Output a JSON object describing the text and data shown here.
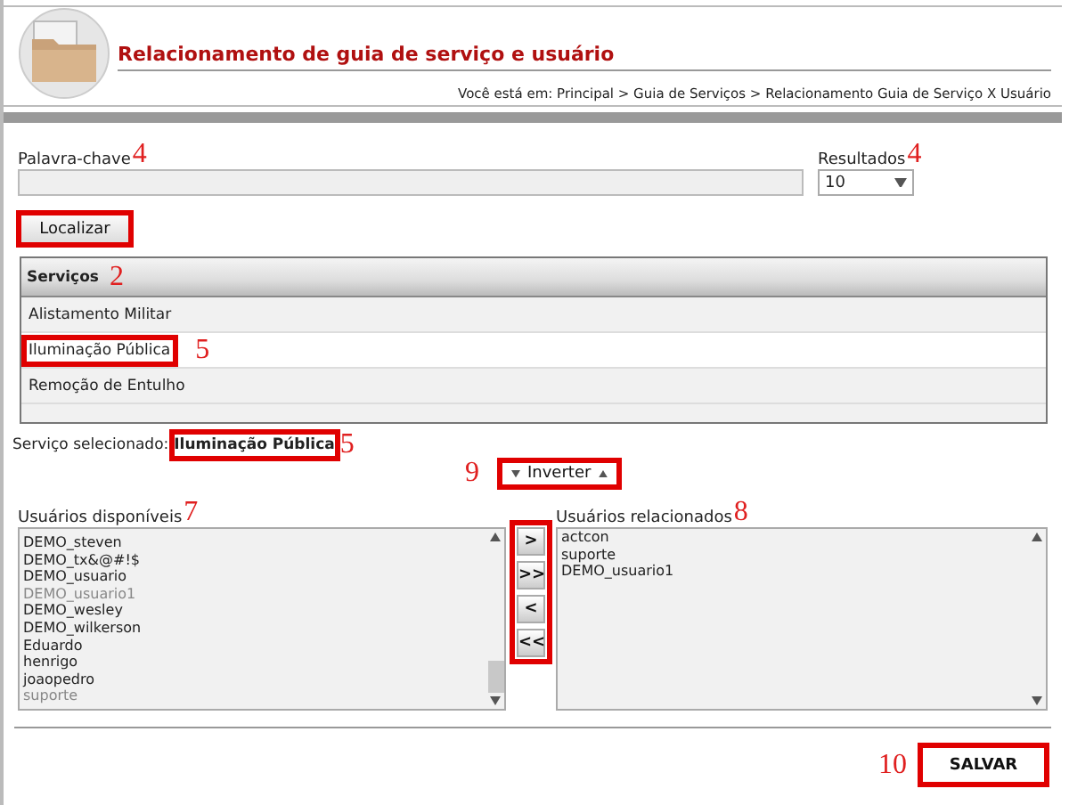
{
  "header": {
    "title": "Relacionamento de guia de serviço e usuário",
    "breadcrumb": "Você está em: Principal > Guia de Serviços > Relacionamento Guia de Serviço X Usuário"
  },
  "search": {
    "keyword_label": "Palavra-chave",
    "keyword_callout": "4",
    "results_label": "Resultados",
    "results_callout": "4",
    "results_value": "10",
    "find_button": {
      "label": "Localizar",
      "highlighted": true
    }
  },
  "services": {
    "header": "Serviços",
    "callout": "2",
    "rows": [
      {
        "label": "Alistamento Militar",
        "selected": false,
        "highlighted": false
      },
      {
        "label": "Iluminação Pública",
        "selected": true,
        "highlighted": true,
        "callout": "5"
      },
      {
        "label": "Remoção de Entulho",
        "selected": false,
        "highlighted": false
      }
    ]
  },
  "selected_service": {
    "label": "Serviço selecionado:",
    "value": "Iluminação Pública",
    "highlighted": true,
    "callout": "5"
  },
  "invert_button": {
    "label": "Inverter",
    "callout": "9",
    "highlighted": true
  },
  "available_users": {
    "label": "Usuários disponíveis",
    "callout": "7",
    "items": [
      {
        "label": "DEMO_steven",
        "disabled": false
      },
      {
        "label": "DEMO_tx&@#!$",
        "disabled": false
      },
      {
        "label": "DEMO_usuario",
        "disabled": false
      },
      {
        "label": "DEMO_usuario1",
        "disabled": true
      },
      {
        "label": "DEMO_wesley",
        "disabled": false
      },
      {
        "label": "DEMO_wilkerson",
        "disabled": false
      },
      {
        "label": "Eduardo",
        "disabled": false
      },
      {
        "label": "henrigo",
        "disabled": false
      },
      {
        "label": "joaopedro",
        "disabled": false
      },
      {
        "label": "suporte",
        "disabled": true
      }
    ]
  },
  "move_buttons": {
    "highlighted": true,
    "buttons": [
      ">",
      ">>",
      "<",
      "<<"
    ]
  },
  "related_users": {
    "label": "Usuários relacionados",
    "callout": "8",
    "items": [
      {
        "label": "actcon",
        "disabled": false
      },
      {
        "label": "suporte",
        "disabled": false
      },
      {
        "label": "DEMO_usuario1",
        "disabled": false
      }
    ]
  },
  "save_button": {
    "label": "SALVAR",
    "callout": "10",
    "highlighted": true
  }
}
